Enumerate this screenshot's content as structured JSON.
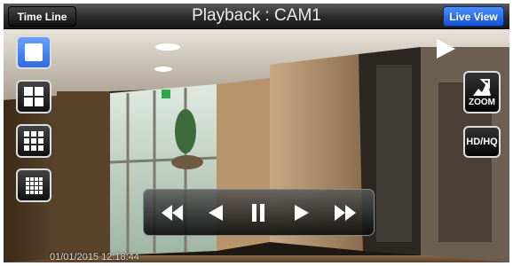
{
  "header": {
    "timeline_label": "Time Line",
    "title": "Playback : CAM1",
    "liveview_label": "Live View"
  },
  "layouts": [
    {
      "name": "layout-1x1",
      "selected": true
    },
    {
      "name": "layout-2x2",
      "selected": false
    },
    {
      "name": "layout-3x3",
      "selected": false
    },
    {
      "name": "layout-4x4",
      "selected": false
    }
  ],
  "side": {
    "zoom_label": "ZOOM",
    "quality_label": "HD/HQ"
  },
  "playback_controls": [
    "fast-backward-icon",
    "reverse-play-icon",
    "pause-icon",
    "play-icon",
    "fast-forward-icon"
  ],
  "overlay": {
    "timestamp": "01/01/2015 12:18:44"
  },
  "colors": {
    "accent": "#2f6ae0",
    "topbar": "#2a2a2a"
  }
}
